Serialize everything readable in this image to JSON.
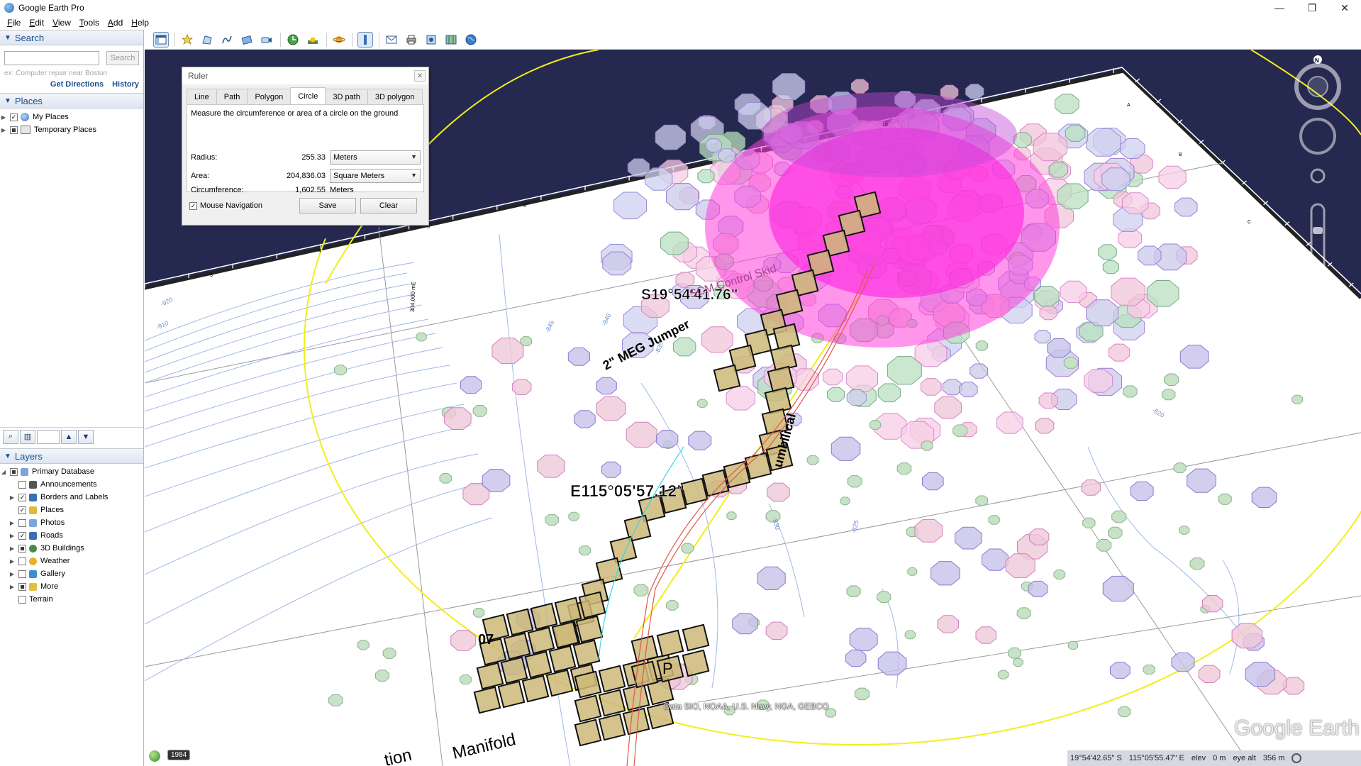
{
  "window": {
    "title": "Google Earth Pro",
    "controls": [
      "—",
      "❐",
      "✕"
    ]
  },
  "menu": [
    "File",
    "Edit",
    "View",
    "Tools",
    "Add",
    "Help"
  ],
  "search": {
    "header": "Search",
    "placeholder": "",
    "button": "Search",
    "hint": "ex: Computer repair near Boston",
    "get_directions": "Get Directions",
    "history": "History"
  },
  "places": {
    "header": "Places",
    "items": [
      {
        "label": "My Places",
        "checked": true
      },
      {
        "label": "Temporary Places",
        "checked": "partial"
      }
    ]
  },
  "layers": {
    "header": "Layers",
    "items": [
      {
        "label": "Primary Database",
        "state": "partial",
        "level": 0
      },
      {
        "label": "Announcements",
        "state": "off",
        "level": 1
      },
      {
        "label": "Borders and Labels",
        "state": "on",
        "level": 1
      },
      {
        "label": "Places",
        "state": "on",
        "level": 1
      },
      {
        "label": "Photos",
        "state": "off",
        "level": 1
      },
      {
        "label": "Roads",
        "state": "on",
        "level": 1
      },
      {
        "label": "3D Buildings",
        "state": "partial",
        "level": 1
      },
      {
        "label": "Weather",
        "state": "off",
        "level": 1
      },
      {
        "label": "Gallery",
        "state": "off",
        "level": 1
      },
      {
        "label": "More",
        "state": "partial",
        "level": 1
      },
      {
        "label": "Terrain",
        "state": "off",
        "level": 1
      }
    ]
  },
  "ruler": {
    "title": "Ruler",
    "close": "✕",
    "tabs": [
      "Line",
      "Path",
      "Polygon",
      "Circle",
      "3D path",
      "3D polygon"
    ],
    "active_tab": "Circle",
    "description": "Measure the circumference or area of a circle on the ground",
    "radius_label": "Radius:",
    "radius_value": "255.33",
    "radius_unit": "Meters",
    "area_label": "Area:",
    "area_value": "204,836.03",
    "area_unit": "Square Meters",
    "circ_label": "Circumference:",
    "circ_value": "1,602.55",
    "circ_unit": "Meters",
    "mouse_nav": "Mouse Navigation",
    "save": "Save",
    "clear": "Clear"
  },
  "map_labels": {
    "lat": "S19°54'41.76\"",
    "lon": "E115°05'57.12\"",
    "skid": "SCM Control Skid",
    "jumper": "2\" MEG Jumper",
    "umbilical": "umbilical",
    "manifold": "Manifold",
    "tion": "tion",
    "seven": "07",
    "p": "P",
    "depths": [
      "-845",
      "-840",
      "-835",
      "-820",
      "-830",
      "-825",
      "-910",
      "-920"
    ],
    "grid_nums": [
      "3",
      "4",
      "5",
      "6",
      "7",
      "8",
      "9",
      "10",
      "11",
      "12",
      "A",
      "B",
      "C"
    ],
    "side_label": "304,000 mE"
  },
  "attribution": "Data SIO, NOAA, U.S. Navy, NGA, GEBCO",
  "logo": "Google Earth",
  "status": {
    "year": "1984",
    "lat": "19°54'42.65\" S",
    "lon": "115°05'55.47\" E",
    "elev_label": "elev",
    "elev": "0 m",
    "eye_label": "eye alt",
    "eye": "356 m"
  },
  "colors": {
    "map_bg": "#25294f",
    "magenta": "#ff3cdc",
    "yellow": "#ffff33",
    "tan": "#c9b877"
  }
}
